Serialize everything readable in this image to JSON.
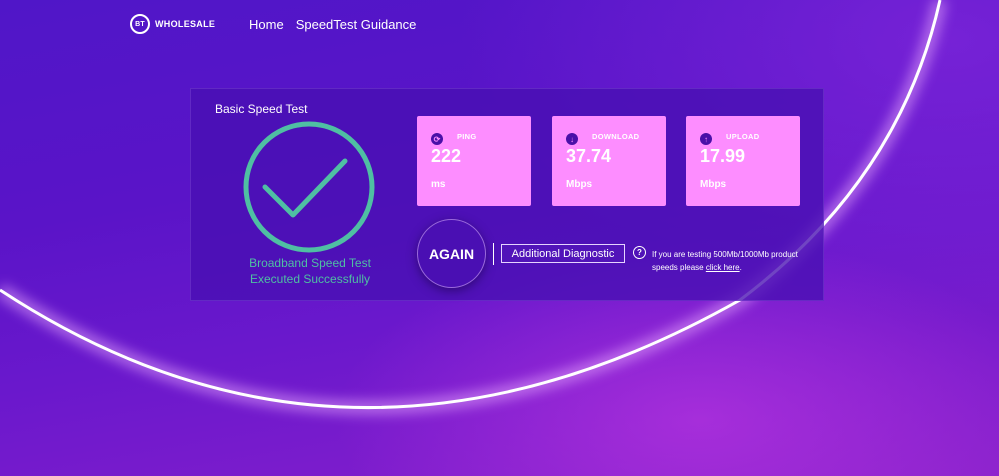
{
  "header": {
    "logo_mark": "BT",
    "logo_text": "WHOLESALE",
    "nav": [
      {
        "label": "Home"
      },
      {
        "label": "SpeedTest Guidance"
      }
    ]
  },
  "panel": {
    "title": "Basic Speed Test",
    "status_line1": "Broadband Speed Test",
    "status_line2": "Executed Successfully",
    "cards": [
      {
        "label": "PING",
        "value": "222",
        "unit": "ms",
        "icon": "ping-icon"
      },
      {
        "label": "DOWNLOAD",
        "value": "37.74",
        "unit": "Mbps",
        "icon": "download-arrow-icon"
      },
      {
        "label": "UPLOAD",
        "value": "17.99",
        "unit": "Mbps",
        "icon": "upload-arrow-icon"
      }
    ],
    "again_label": "AGAIN",
    "diagnostic_label": "Additional Diagnostic",
    "help_glyph": "?",
    "note_text": "If you are testing 500Mb/1000Mb product speeds please ",
    "note_link": "click here",
    "note_end": "."
  },
  "colors": {
    "background": "#5a14c8",
    "panel": "#4810b2",
    "card": "#fd8dff",
    "check": "#4fbfa3"
  }
}
